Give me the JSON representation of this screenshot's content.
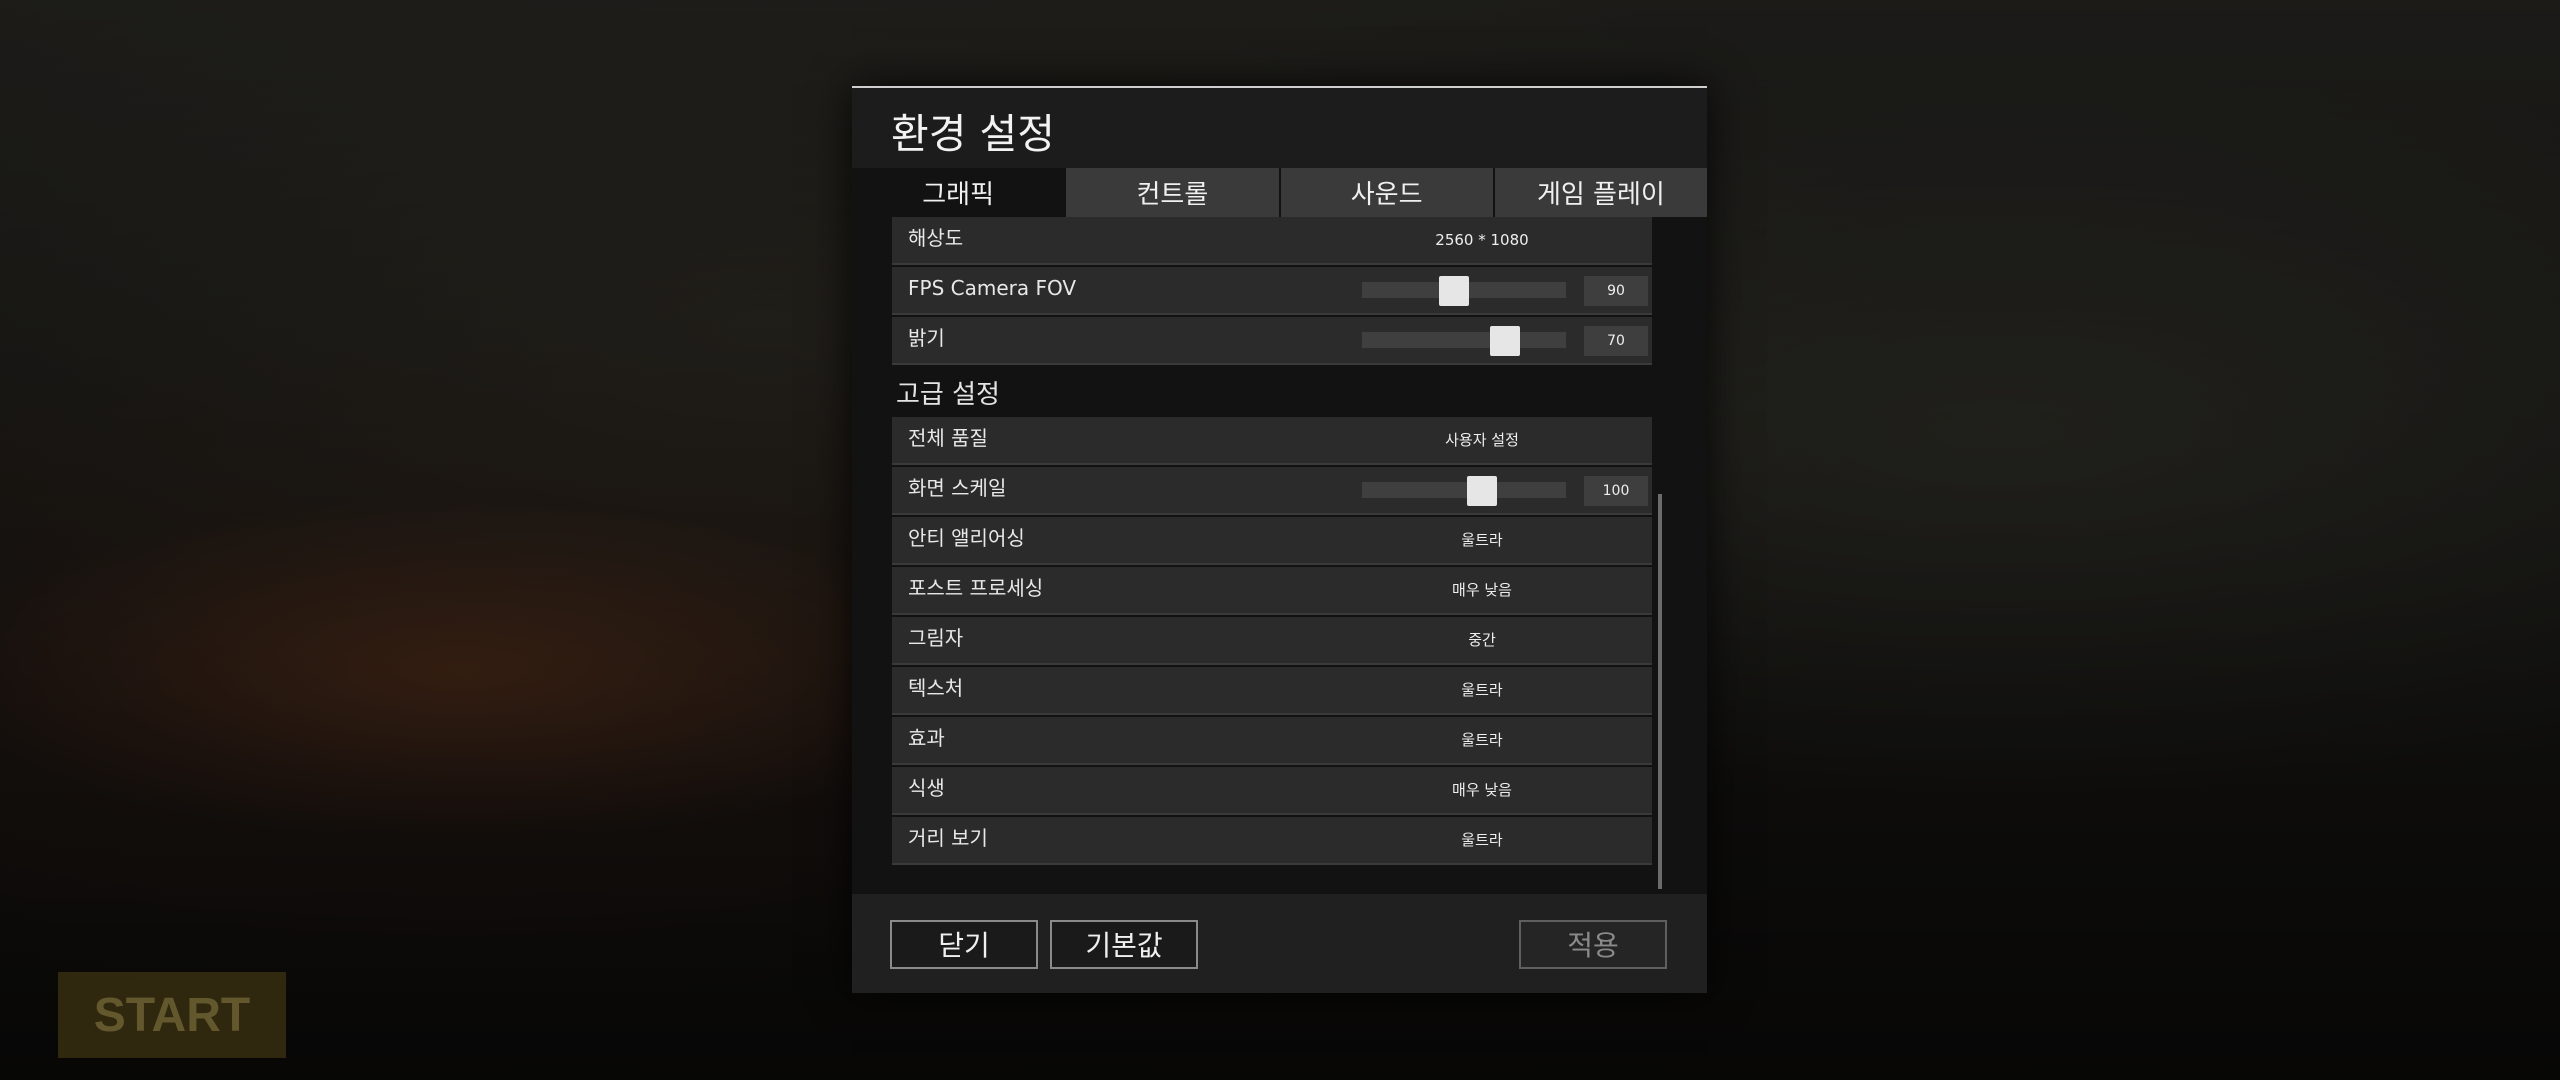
{
  "dialog": {
    "title": "환경 설정",
    "tabs": [
      "그래픽",
      "컨트롤",
      "사운드",
      "게임 플레이"
    ],
    "active_tab": 0
  },
  "basic": [
    {
      "label": "해상도",
      "value": "2560 * 1080"
    },
    {
      "label": "FPS Camera FOV",
      "slider_value": "90",
      "level": 0.45
    },
    {
      "label": "밝기",
      "slider_value": "70",
      "level": 0.7
    }
  ],
  "advanced": {
    "heading": "고급 설정",
    "rows": [
      {
        "label": "전체 품질",
        "value": "사용자 설정"
      },
      {
        "label": "화면 스케일",
        "slider_value": "100",
        "level": 0.59
      },
      {
        "label": "안티 앨리어싱",
        "value": "울트라"
      },
      {
        "label": "포스트 프로세싱",
        "value": "매우 낮음"
      },
      {
        "label": "그림자",
        "value": "중간"
      },
      {
        "label": "텍스처",
        "value": "울트라"
      },
      {
        "label": "효과",
        "value": "울트라"
      },
      {
        "label": "식생",
        "value": "매우 낮음"
      },
      {
        "label": "거리 보기",
        "value": "울트라"
      }
    ]
  },
  "footer": {
    "close": "닫기",
    "defaults": "기본값",
    "apply": "적용"
  },
  "background": {
    "start": "START"
  }
}
